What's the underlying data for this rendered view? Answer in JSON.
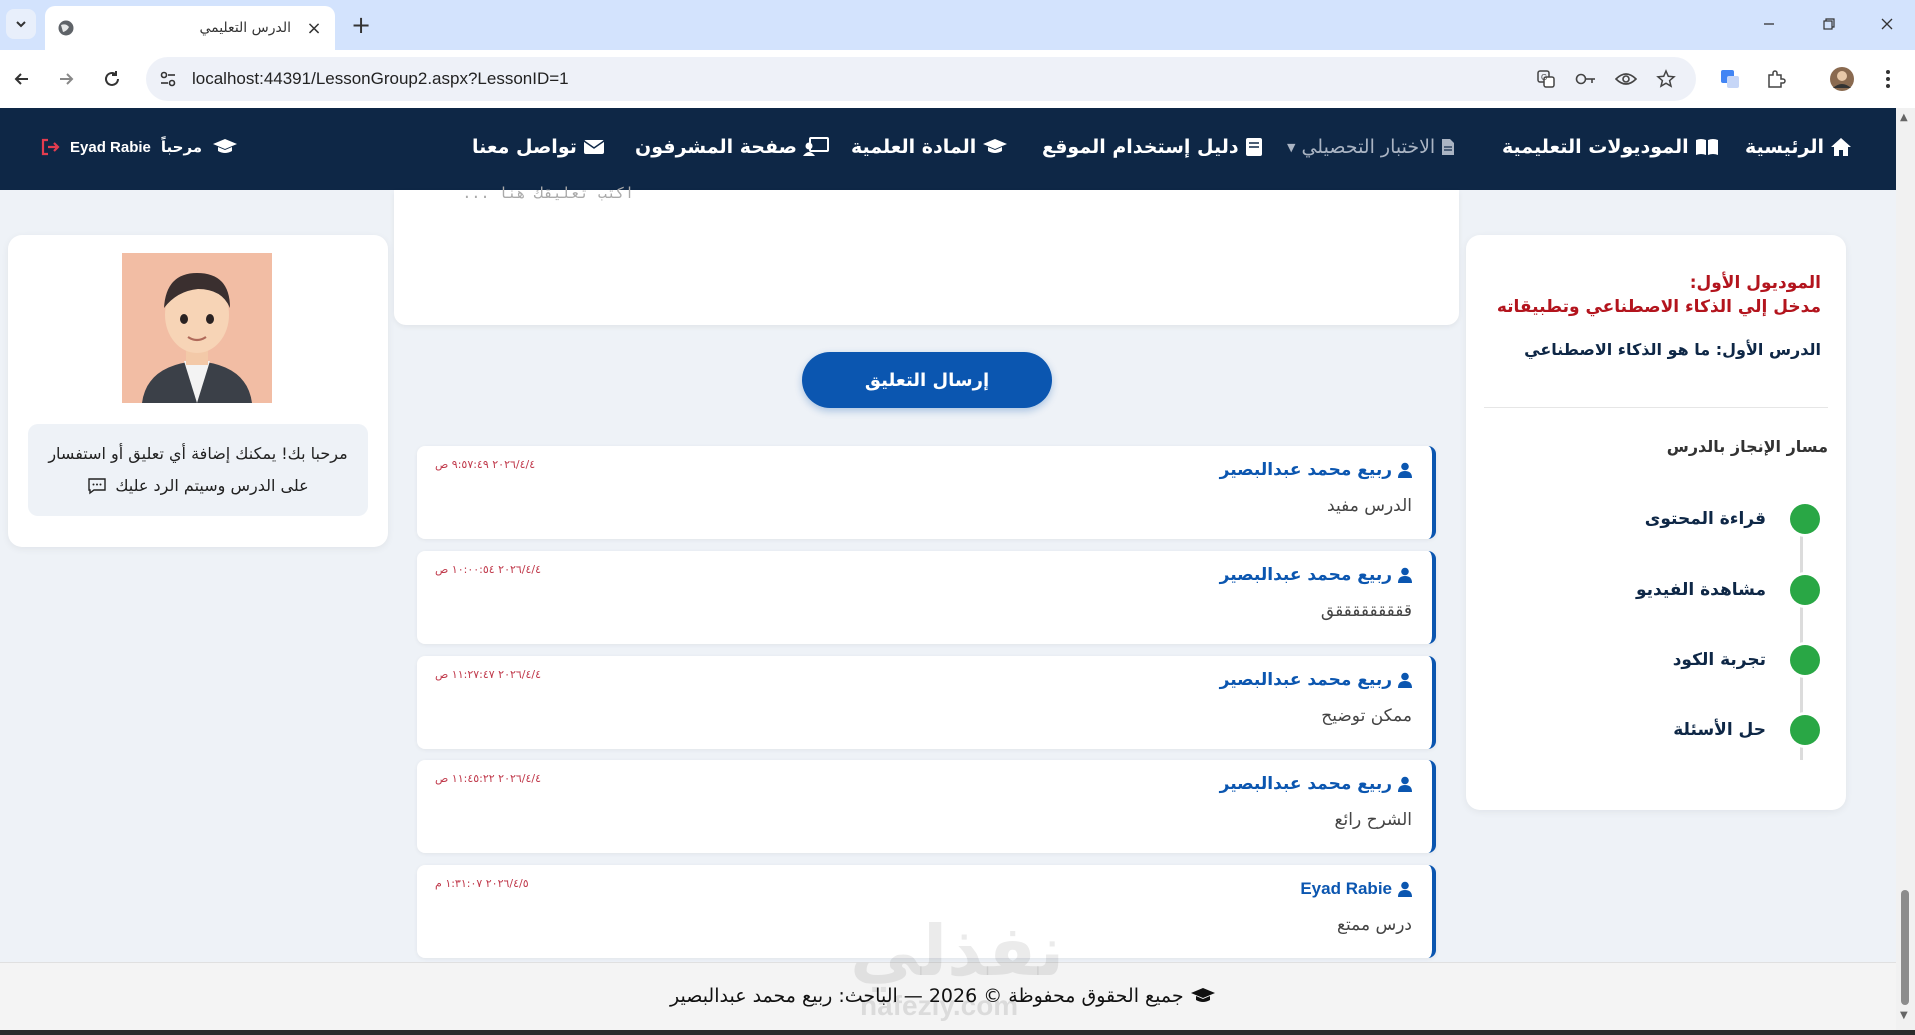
{
  "browser": {
    "tab_title": "الدرس التعليمي",
    "url": "localhost:44391/LessonGroup2.aspx?LessonID=1"
  },
  "navbar": {
    "items": [
      {
        "label": "الرئيسية",
        "icon": "home-icon"
      },
      {
        "label": "الموديولات التعليمية",
        "icon": "book-open-icon"
      },
      {
        "label": "الاختبار التحصيلي",
        "icon": "file-icon",
        "muted": true
      },
      {
        "label": "دليل إستخدام الموقع",
        "icon": "book-icon"
      },
      {
        "label": "المادة العلمية",
        "icon": "graduation-cap-icon"
      },
      {
        "label": "صفحة المشرفون",
        "icon": "teacher-icon"
      },
      {
        "label": "تواصل معنا",
        "icon": "envelope-icon"
      }
    ],
    "greeting": "مرحباً",
    "user_name": "Eyad Rabie"
  },
  "profile": {
    "welcome_line1": "مرحبا بك! يمكنك إضافة أي تعليق أو استفسار",
    "welcome_line2": "على الدرس وسيتم الرد عليك"
  },
  "comment_form": {
    "placeholder": "اكتب تعليقك هنا ...",
    "submit_label": "إرسال التعليق"
  },
  "comments": [
    {
      "author": "ربيع محمد عبدالبصير",
      "text": "الدرس مفيد",
      "time": "٢٠٢٦/٤/٤ ٩:٥٧:٤٩ ص"
    },
    {
      "author": "ربيع محمد عبدالبصير",
      "text": "قققققققققق",
      "time": "٢٠٢٦/٤/٤ ١٠:٠٠:٥٤ ص"
    },
    {
      "author": "ربيع محمد عبدالبصير",
      "text": "ممكن توضيح",
      "time": "٢٠٢٦/٤/٤ ١١:٢٧:٤٧ ص"
    },
    {
      "author": "ربيع محمد عبدالبصير",
      "text": "الشرح رائع",
      "time": "٢٠٢٦/٤/٤ ١١:٤٥:٢٢ ص"
    },
    {
      "author": "Eyad Rabie",
      "text": "درس ممتع",
      "time": "٢٠٢٦/٤/٥ ١:٣١:٠٧ م"
    }
  ],
  "lesson": {
    "module_label": "الموديول الأول:",
    "module_title": "مدخل إلي الذكاء الاصطناعي وتطبيقاته",
    "lesson_title": "الدرس الأول: ما هو الذكاء الاصطناعي",
    "progress_title": "مسار الإنجاز بالدرس",
    "steps": [
      "قراءة المحتوى",
      "مشاهدة الفيديو",
      "تجربة الكود",
      "حل الأسئلة"
    ],
    "step_color": "#29a745"
  },
  "footer": {
    "text": "جميع الحقوق محفوظة © 2026 — الباحث: ربيع محمد عبدالبصير"
  },
  "watermark": {
    "arabic": "نفذلي",
    "latin": "nafezly.com"
  },
  "colors": {
    "navbar": "#0e2746",
    "accent": "#0b56b0",
    "time": "#c0394b",
    "module": "#b3141d"
  }
}
